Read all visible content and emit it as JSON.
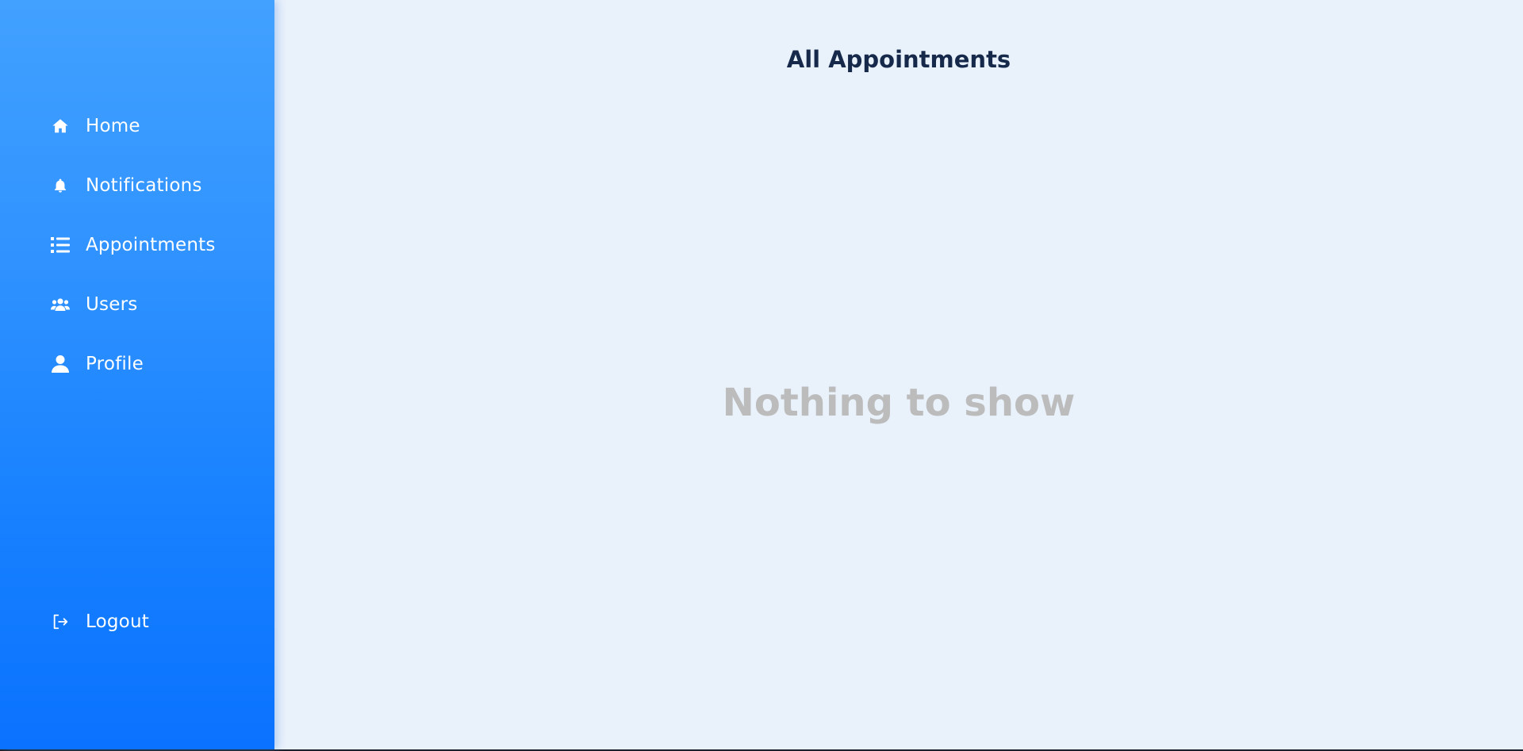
{
  "sidebar": {
    "items": [
      {
        "label": "Home",
        "icon": "home-icon"
      },
      {
        "label": "Notifications",
        "icon": "bell-icon"
      },
      {
        "label": "Appointments",
        "icon": "list-icon"
      },
      {
        "label": "Users",
        "icon": "users-icon"
      },
      {
        "label": "Profile",
        "icon": "user-icon"
      }
    ],
    "logout": {
      "label": "Logout",
      "icon": "logout-icon"
    }
  },
  "main": {
    "title": "All Appointments",
    "empty_message": "Nothing to show"
  },
  "colors": {
    "sidebar_top": "#42a1ff",
    "sidebar_bottom": "#0a72ff",
    "main_bg": "#e9f1fb",
    "title": "#16294a",
    "empty_text": "#bcbcbc",
    "nav_text": "#ffffff"
  }
}
